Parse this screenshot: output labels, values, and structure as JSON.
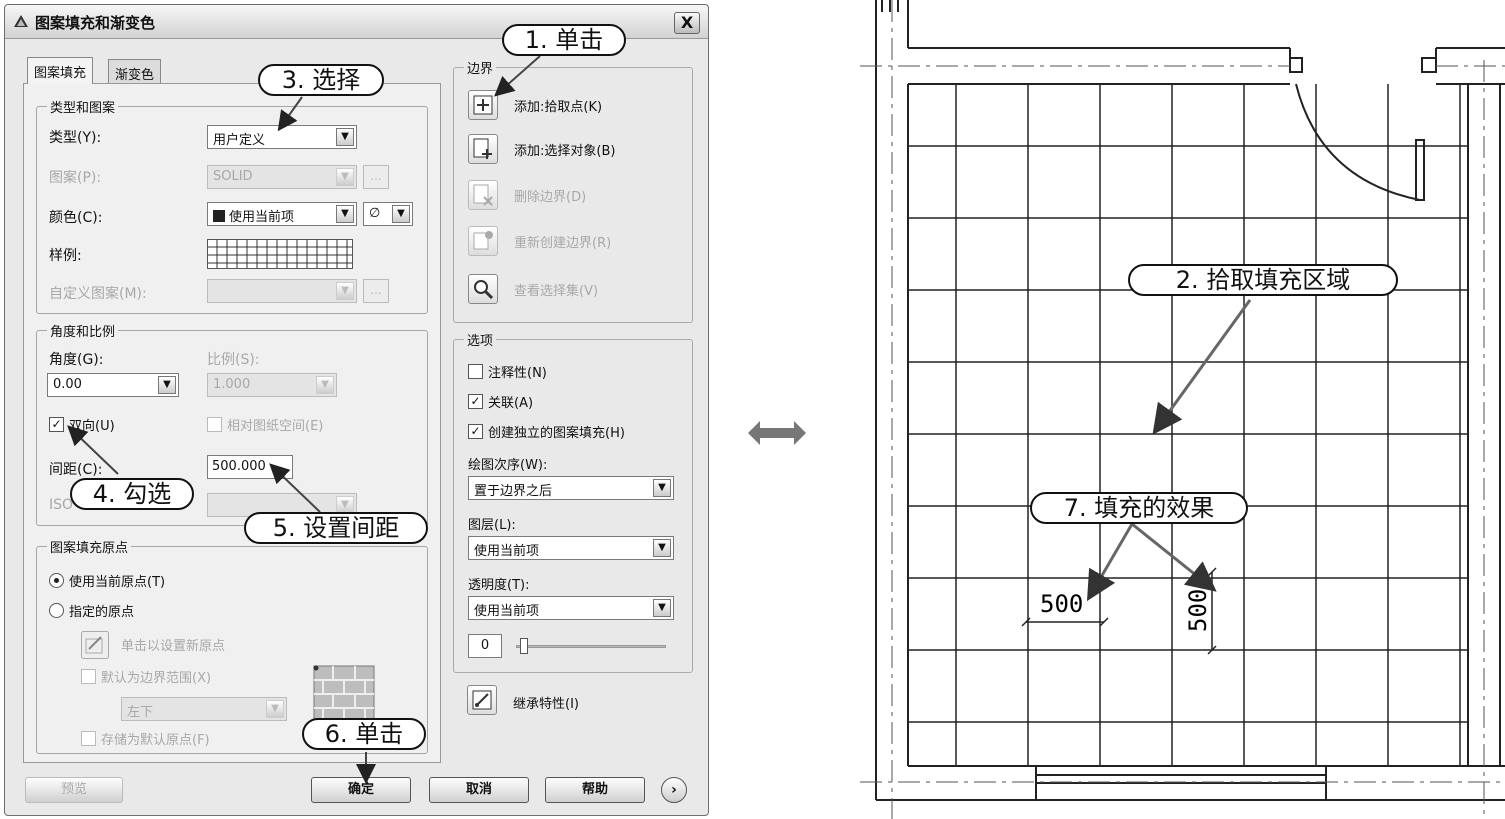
{
  "dialog": {
    "title": "图案填充和渐变色",
    "close_label": "X",
    "tabs": [
      {
        "label": "图案填充"
      },
      {
        "label": "渐变色"
      }
    ],
    "type_group": {
      "title": "类型和图案",
      "type_label": "类型(Y):",
      "type_value": "用户定义",
      "pattern_label": "图案(P):",
      "pattern_value": "SOLID",
      "color_label": "颜色(C):",
      "color_value": "使用当前项",
      "color_none_symbol": "∅",
      "sample_label": "样例:",
      "custom_label": "自定义图案(M):",
      "ellipsis": "..."
    },
    "angle_group": {
      "title": "角度和比例",
      "angle_label": "角度(G):",
      "angle_value": "0.00",
      "scale_label": "比例(S):",
      "scale_value": "1.000",
      "double_label": "双向(U)",
      "relative_label": "相对图纸空间(E)",
      "spacing_label": "间距(C):",
      "spacing_value": "500.000",
      "iso_label": "ISO"
    },
    "origin_group": {
      "title": "图案填充原点",
      "use_current": "使用当前原点(T)",
      "specified": "指定的原点",
      "click_set": "单击以设置新原点",
      "default_extent": "默认为边界范围(X)",
      "extent_value": "左下",
      "store_default": "存储为默认原点(F)"
    },
    "boundary_group": {
      "title": "边界",
      "add_pick": "添加:拾取点(K)",
      "add_select": "添加:选择对象(B)",
      "remove": "删除边界(D)",
      "recreate": "重新创建边界(R)",
      "view_selection": "查看选择集(V)"
    },
    "options_group": {
      "title": "选项",
      "annotative": "注释性(N)",
      "associative": "关联(A)",
      "separate": "创建独立的图案填充(H)",
      "draw_order_label": "绘图次序(W):",
      "draw_order_value": "置于边界之后",
      "layer_label": "图层(L):",
      "layer_value": "使用当前项",
      "transparency_label": "透明度(T):",
      "transparency_value": "使用当前项",
      "transparency_number": "0"
    },
    "inherit_label": "继承特性(I)",
    "buttons": {
      "preview": "预览",
      "ok": "确定",
      "cancel": "取消",
      "help": "帮助",
      "more": "›"
    },
    "checked_mark": "✓"
  },
  "callouts": {
    "c1": "1. 单击",
    "c2": "2. 拾取填充区域",
    "c3": "3. 选择",
    "c4": "4. 勾选",
    "c5": "5. 设置间距",
    "c6": "6. 单击",
    "c7": "7. 填充的效果"
  },
  "drawing": {
    "dim_horizontal": "500",
    "dim_vertical": "500"
  },
  "icons": [
    "app-icon",
    "close-icon",
    "pick-point-icon",
    "select-objects-icon",
    "remove-boundary-icon",
    "recreate-boundary-icon",
    "magnifier-icon",
    "inherit-icon",
    "origin-icon",
    "brick-preview-icon",
    "double-arrow-icon"
  ]
}
